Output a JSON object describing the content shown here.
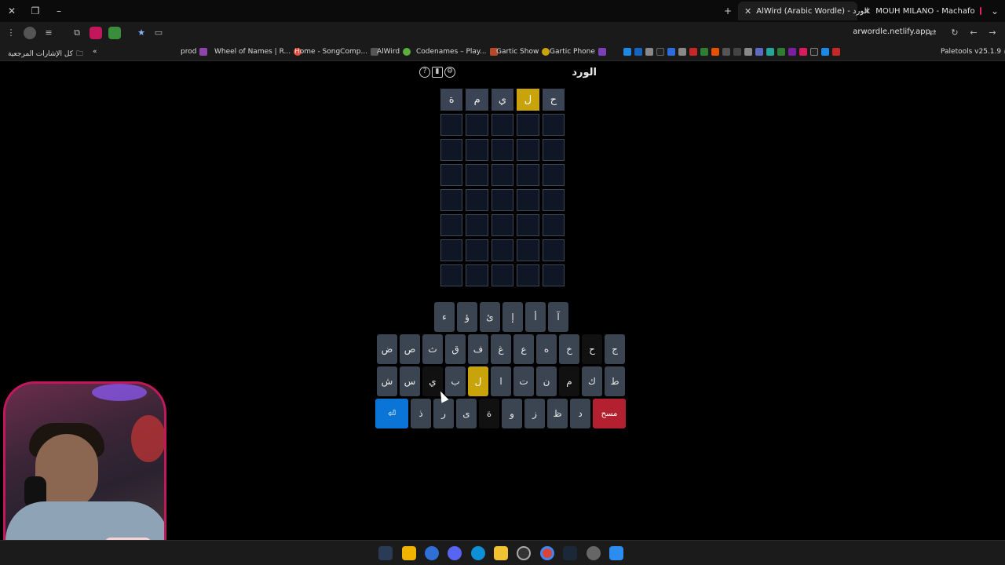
{
  "browser": {
    "tabs": [
      {
        "label": "AlWird (Arabic Wordle) - الورد",
        "active": true
      },
      {
        "label": "MOUH MILANO - Machafo",
        "active": false
      }
    ],
    "url": "arwordle.netlify.app",
    "bookmarks": [
      {
        "label": "كل الإشارات المرجعية",
        "icon": "folder-icon"
      },
      {
        "label": "prod",
        "icon": "twitch-icon"
      },
      {
        "label": "Wheel of Names | R...",
        "icon": "wheel-icon"
      },
      {
        "label": "Home - SongComp...",
        "icon": "home-icon"
      },
      {
        "label": "AlWird",
        "icon": "alwird-icon"
      },
      {
        "label": "Codenames – Play...",
        "icon": "codenames-icon"
      },
      {
        "label": "Gartic Show",
        "icon": "gartic-icon"
      },
      {
        "label": "Gartic Phone",
        "icon": "phone-icon"
      },
      {
        "label": "Paletools v25.1.9",
        "icon": "paletools-icon"
      }
    ]
  },
  "game": {
    "title": "الورد",
    "rows": [
      [
        "ة",
        "م",
        "ي",
        "ل",
        "ح"
      ],
      [
        "",
        "",
        "",
        "",
        ""
      ],
      [
        "",
        "",
        "",
        "",
        ""
      ],
      [
        "",
        "",
        "",
        "",
        ""
      ],
      [
        "",
        "",
        "",
        "",
        ""
      ],
      [
        "",
        "",
        "",
        "",
        ""
      ],
      [
        "",
        "",
        "",
        "",
        ""
      ],
      [
        "",
        "",
        "",
        "",
        ""
      ]
    ],
    "row_states": [
      [
        "filled",
        "filled",
        "filled",
        "present",
        "filled"
      ]
    ],
    "keyboard": {
      "row1": [
        "ء",
        "ؤ",
        "ئ",
        "إ",
        "أ",
        "آ"
      ],
      "row2": [
        "ض",
        "ص",
        "ث",
        "ق",
        "ف",
        "غ",
        "ع",
        "ه",
        "خ",
        "ح",
        "ج"
      ],
      "row3": [
        "ش",
        "س",
        "ي",
        "ب",
        "ل",
        "ا",
        "ت",
        "ن",
        "م",
        "ك",
        "ط"
      ],
      "row4": [
        "ذ",
        "ر",
        "ى",
        "ة",
        "و",
        "ز",
        "ظ",
        "د"
      ],
      "enter_label": "⏎",
      "delete_label": "مسح"
    },
    "colors": {
      "present": "#c9a30a",
      "enter": "#0a75d6",
      "delete": "#b3202f"
    }
  }
}
